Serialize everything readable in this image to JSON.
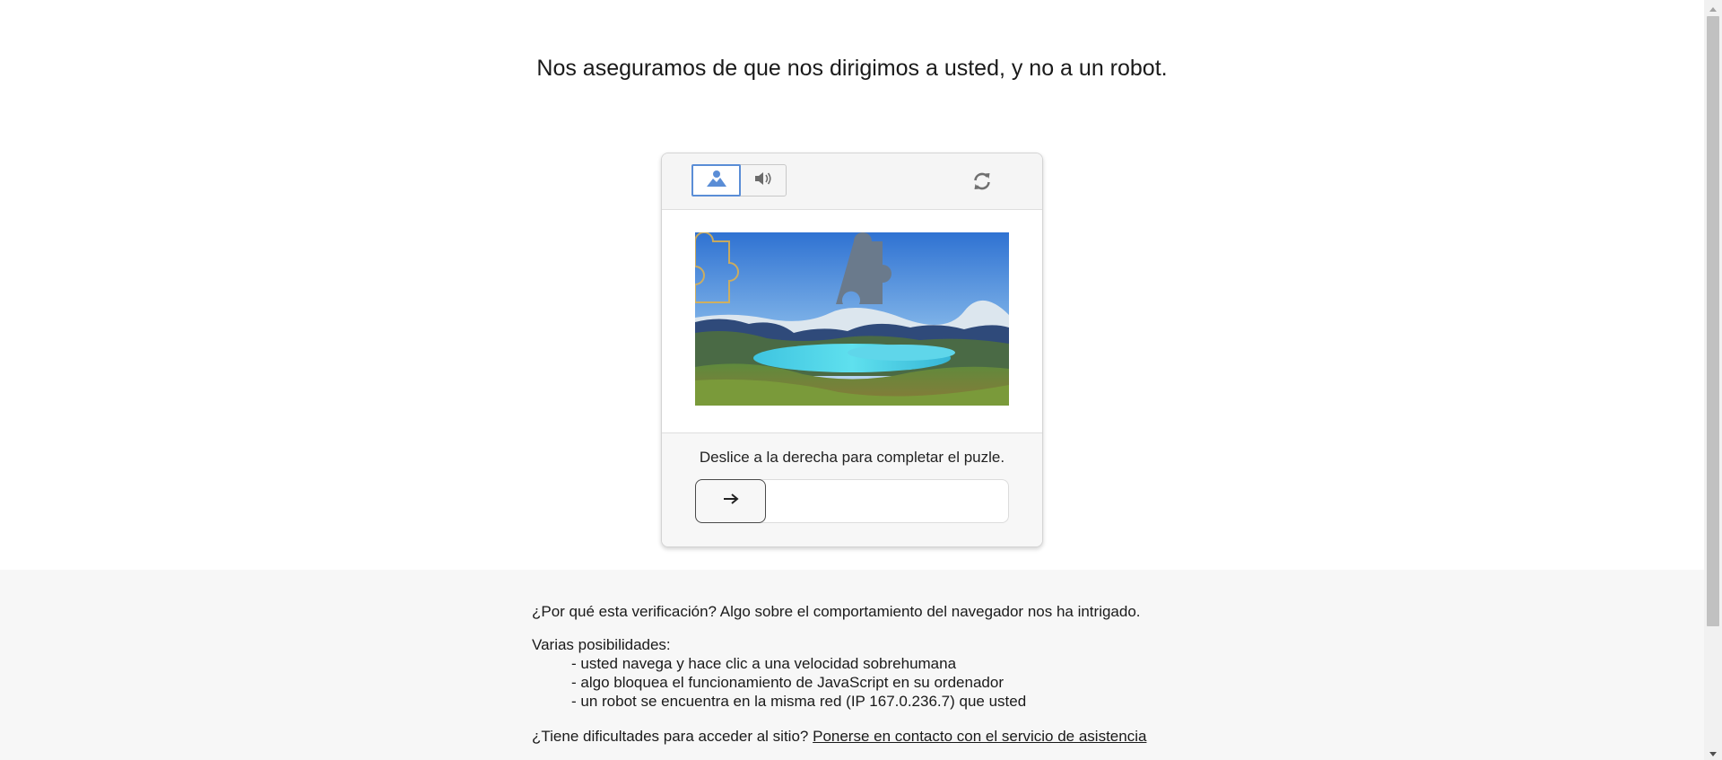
{
  "headline": "Nos aseguramos de que nos dirigimos a usted, y no a un robot.",
  "captcha": {
    "mode_image_icon": "image-icon",
    "mode_audio_icon": "speaker-icon",
    "refresh_icon": "refresh-icon",
    "instruction": "Deslice a la derecha para completar el puzle.",
    "slider_icon": "arrow-right-icon",
    "slider_progress": 0
  },
  "info": {
    "why": "¿Por qué esta verificación? Algo sobre el comportamiento del navegador nos ha intrigado.",
    "possibilities_title": "Varias posibilidades:",
    "reasons": [
      "- usted navega y hace clic a una velocidad sobrehumana",
      "- algo bloquea el funcionamiento de JavaScript en su ordenador",
      "- un robot se encuentra en la misma red (IP 167.0.236.7) que usted"
    ],
    "help_text": "¿Tiene dificultades para acceder al sitio?",
    "help_link": "Ponerse en contacto con el servicio de asistencia"
  },
  "colors": {
    "accent": "#5a8dd6",
    "puzzle_piece": "#6a7a8c",
    "puzzle_outline": "#e0b24a",
    "footer_bg": "#f7f7f7"
  }
}
